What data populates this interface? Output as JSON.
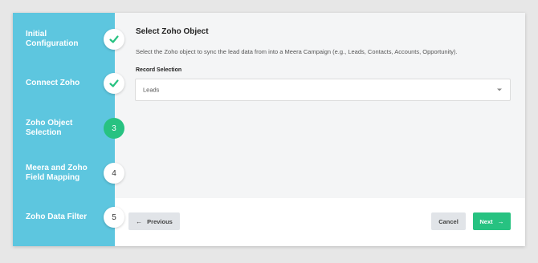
{
  "steps": [
    {
      "label": "Initial Configuration",
      "status": "complete",
      "badge": "check-icon"
    },
    {
      "label": "Connect Zoho",
      "status": "complete",
      "badge": "check-icon"
    },
    {
      "label": "Zoho Object Selection",
      "status": "active",
      "number": "3"
    },
    {
      "label": "Meera and Zoho Field Mapping",
      "status": "pending",
      "number": "4"
    },
    {
      "label": "Zoho Data Filter",
      "status": "pending",
      "number": "5"
    }
  ],
  "main": {
    "title": "Select Zoho Object",
    "description": "Select the Zoho object to sync the lead data from into a Meera Campaign (e.g., Leads, Contacts, Accounts, Opportunity).",
    "field_label": "Record Selection",
    "selected_value": "Leads"
  },
  "footer": {
    "previous_label": "Previous",
    "cancel_label": "Cancel",
    "next_label": "Next"
  },
  "colors": {
    "sidebar": "#5dc6df",
    "accent": "#27c281",
    "background": "#e7e7e7"
  }
}
